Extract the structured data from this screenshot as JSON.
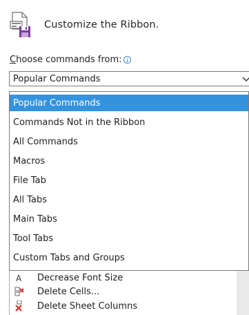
{
  "header": {
    "title": "Customize the Ribbon."
  },
  "commands_label": {
    "text": "Choose commands from:",
    "accelerator": "C",
    "rest": "hoose commands from:"
  },
  "combo": {
    "selected_value": "Popular Commands"
  },
  "dropdown": {
    "options": [
      "Popular Commands",
      "Commands Not in the Ribbon",
      "All Commands",
      "Macros",
      "File Tab",
      "All Tabs",
      "Main Tabs",
      "Tool Tabs",
      "Custom Tabs and Groups"
    ],
    "selected_index": 0
  },
  "command_list": {
    "items": [
      {
        "label": "Decrease Font Size",
        "icon": "decrease-font-size-icon"
      },
      {
        "label": "Delete Cells...",
        "icon": "delete-cells-icon"
      },
      {
        "label": "Delete Sheet Columns",
        "icon": "delete-sheet-columns-icon"
      }
    ]
  },
  "colors": {
    "selection": "#3393df",
    "info_icon": "#3a86d9",
    "ribbon_icon_purple": "#7a3c9a"
  }
}
